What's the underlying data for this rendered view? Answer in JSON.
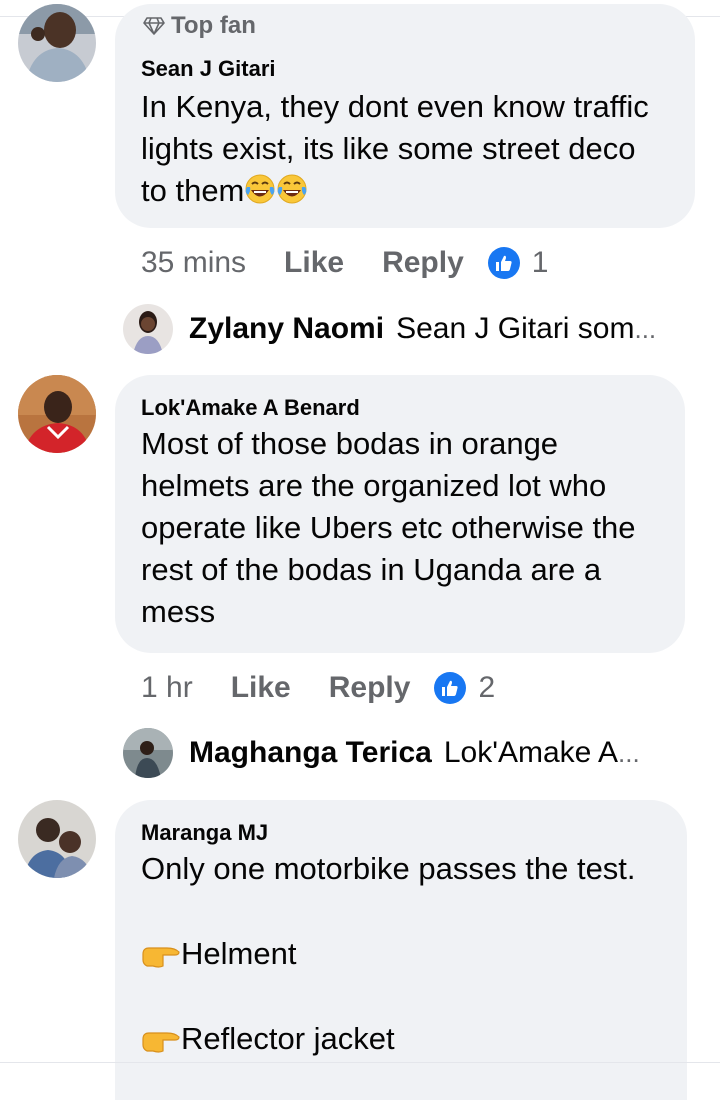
{
  "comments": [
    {
      "badge": "Top fan",
      "author": "Sean J Gitari",
      "line1": "In Kenya, they dont even know traffic",
      "line2": "lights exist, its like some street deco",
      "line3": "to them",
      "time": "35 mins",
      "like_label": "Like",
      "reply_label": "Reply",
      "likes": "1",
      "reply": {
        "name": "Zylany Naomi",
        "preview": "Sean J Gitari som",
        "ellipsis": "..."
      }
    },
    {
      "author": "Lok'Amake A Benard",
      "line1": "Most of those bodas in orange",
      "line2": "helmets are the organized lot who",
      "line3": "operate like Ubers etc otherwise the",
      "line4": "rest of the bodas in Uganda are a",
      "line5": "mess",
      "time": "1 hr",
      "like_label": "Like",
      "reply_label": "Reply",
      "likes": "2",
      "reply": {
        "name": "Maghanga Terica",
        "preview": "Lok'Amake A ",
        "ellipsis": "..."
      }
    },
    {
      "author": "Maranga MJ",
      "line1": "Only one motorbike passes the test.",
      "item1": "Helment",
      "item2": "Reflector jacket"
    }
  ],
  "colors": {
    "bubble": "#f0f2f5",
    "meta": "#65676b",
    "like_blue": "#1877f2"
  },
  "icons": [
    "diamond-icon",
    "laughing-tears-emoji",
    "like-thumb-icon",
    "pointing-hand-emoji"
  ]
}
